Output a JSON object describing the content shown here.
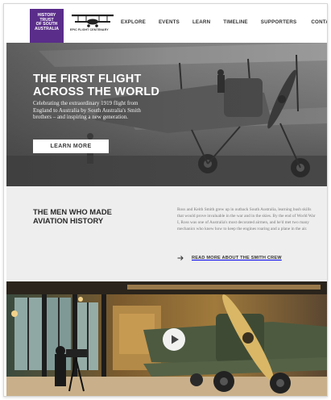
{
  "logo": {
    "lines": [
      "History",
      "Trust",
      "of South",
      "Australia"
    ]
  },
  "centenary": {
    "label": "EPIC FLIGHT CENTENARY"
  },
  "nav": {
    "items": [
      {
        "label": "EXPLORE"
      },
      {
        "label": "EVENTS"
      },
      {
        "label": "LEARN"
      },
      {
        "label": "TIMELINE"
      },
      {
        "label": "SUPPORTERS"
      },
      {
        "label": "CONTACT"
      }
    ]
  },
  "hero": {
    "title": "THE FIRST FLIGHT ACROSS THE WORLD",
    "text": "Celebrating the extraordinary 1919 flight from England to Australia by South Australia's Smith brothers – and inspiring a new generation.",
    "button_label": "LEARN MORE"
  },
  "intro": {
    "title": "THE MEN WHO MADE AVIATION HISTORY",
    "text": "Ross and Keith Smith grew up in outback South Australia, learning bush skills that would prove invaluable in the war and in the skies. By the end of World War I, Ross was one of Australia's most decorated airmen, and he'd met two many mechanics who knew how to keep the engines roaring and a plane in the air.",
    "link_label": "READ MORE ABOUT THE SMITH CREW"
  },
  "colors": {
    "logo_purple": "#5a2d8a",
    "hero_overlay": "#6e6e6e",
    "intro_bg": "#eeeeee",
    "button_bg": "#ffffff"
  },
  "icons": {
    "arrow": "arrow-right-icon",
    "play": "play-icon"
  }
}
